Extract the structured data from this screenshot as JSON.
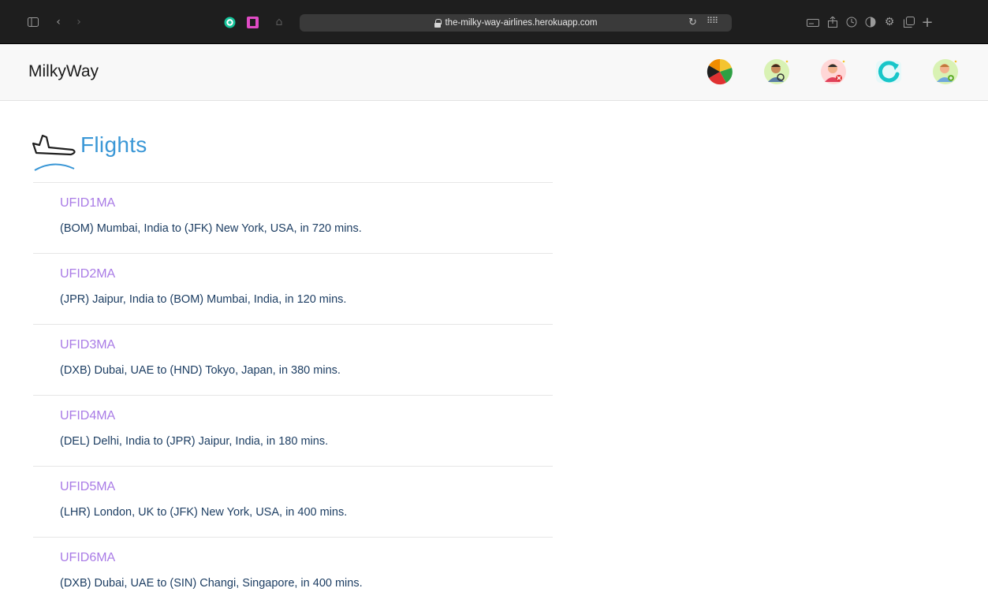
{
  "browser": {
    "url": "the-milky-way-airlines.herokuapp.com",
    "icons": [
      "sidebar-icon",
      "back-icon",
      "forward-icon",
      "grammarly-icon",
      "bookmark-icon",
      "home-icon",
      "reload-icon",
      "grid-icon",
      "reader-icon",
      "share-icon",
      "history-icon",
      "privacy-icon",
      "settings-icon",
      "tabs-icon",
      "new-tab-icon"
    ]
  },
  "navbar": {
    "brand": "MilkyWay",
    "icons": [
      "stats-pie-icon",
      "user-search-icon",
      "user-remove-icon",
      "refresh-icon",
      "user-add-icon"
    ]
  },
  "page": {
    "title": "Flights"
  },
  "flights": [
    {
      "id": "UFID1MA",
      "route": "(BOM) Mumbai, India to (JFK) New York, USA, in 720 mins."
    },
    {
      "id": "UFID2MA",
      "route": "(JPR) Jaipur, India to (BOM) Mumbai, India, in 120 mins."
    },
    {
      "id": "UFID3MA",
      "route": "(DXB) Dubai, UAE to (HND) Tokyo, Japan, in 380 mins."
    },
    {
      "id": "UFID4MA",
      "route": "(DEL) Delhi, India to (JPR) Jaipur, India, in 180 mins."
    },
    {
      "id": "UFID5MA",
      "route": "(LHR) London, UK to (JFK) New York, USA, in 400 mins."
    },
    {
      "id": "UFID6MA",
      "route": "(DXB) Dubai, UAE to (SIN) Changi, Singapore, in 400 mins."
    }
  ]
}
